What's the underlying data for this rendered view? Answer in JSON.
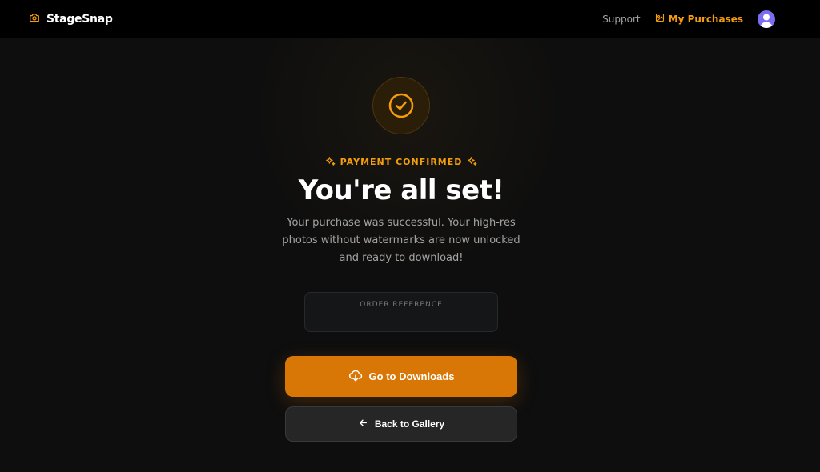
{
  "nav": {
    "brand": "StageSnap",
    "support": "Support",
    "my_purchases": "My Purchases"
  },
  "status": {
    "badge": "PAYMENT CONFIRMED",
    "title": "You're all set!",
    "description": "Your purchase was successful. Your high-res photos without watermarks are now unlocked and ready to download!"
  },
  "order": {
    "label": "ORDER REFERENCE",
    "value": ""
  },
  "actions": {
    "primary_label": "Go to Downloads",
    "secondary_label": "Back to Gallery"
  },
  "colors": {
    "accent": "#f59e0b",
    "primary_button": "#d97706",
    "background": "#0e0e0e",
    "avatar": "#7c6cf0"
  },
  "icons": {
    "brand": "camera-icon",
    "purchases": "image-icon",
    "status": "check-circle-icon",
    "badge": "sparkles-icon",
    "primary": "cloud-download-icon",
    "secondary": "arrow-left-icon"
  }
}
